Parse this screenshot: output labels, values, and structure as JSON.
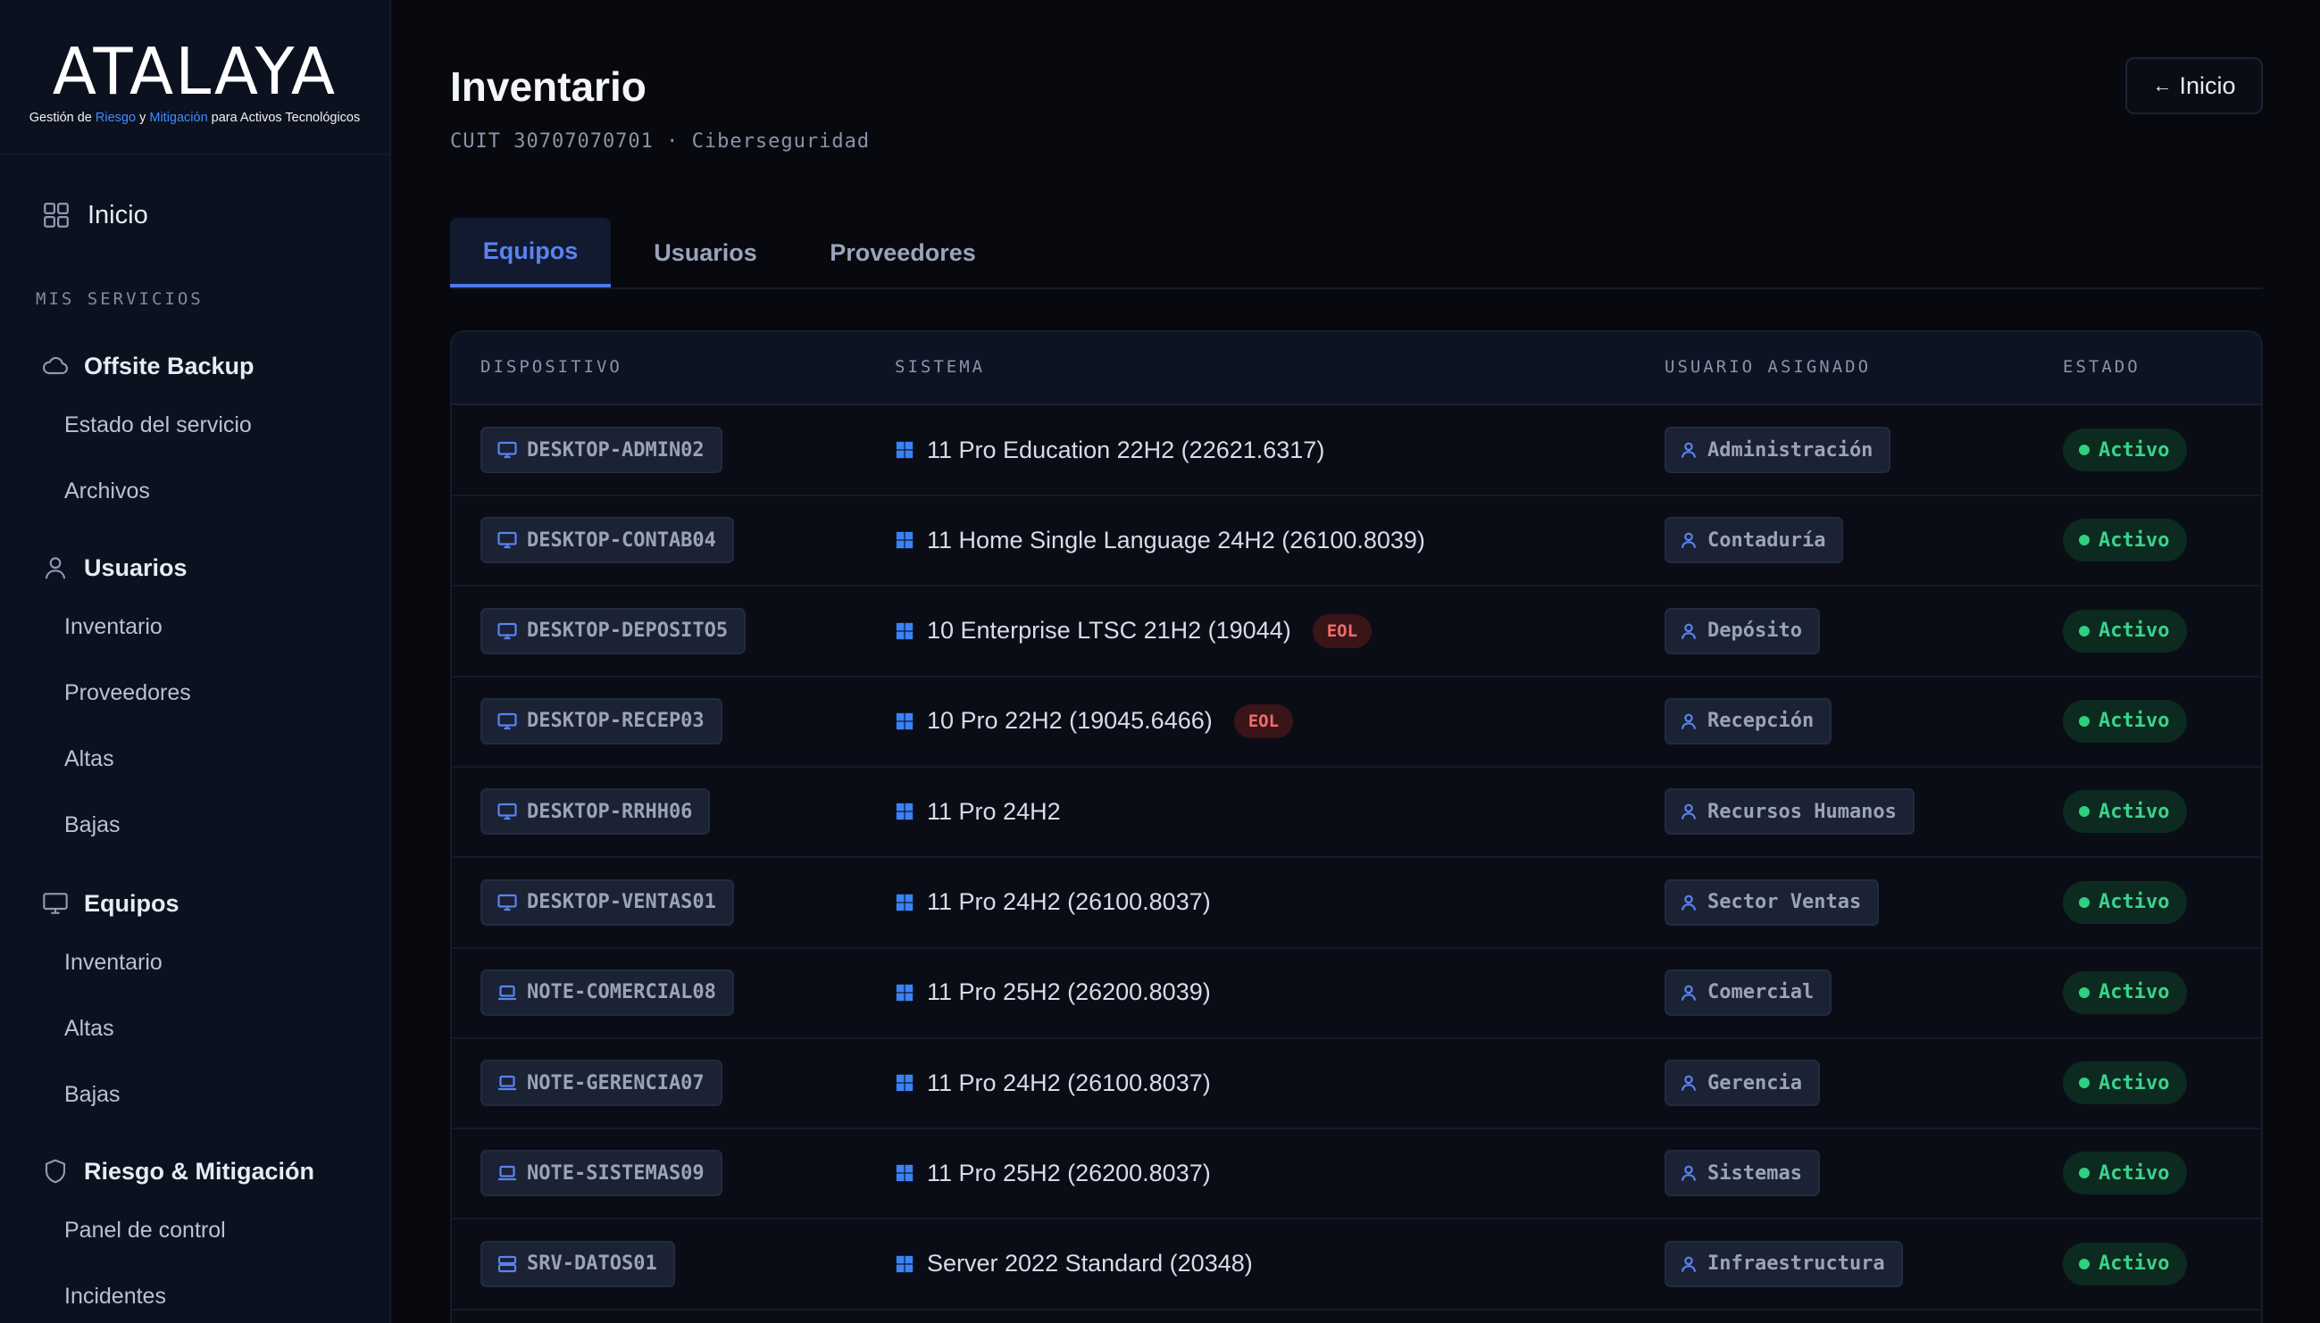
{
  "brand": {
    "name": "ATALAYA",
    "tagline_parts": [
      "Gestión de ",
      "Riesgo",
      " y ",
      "Mitigación",
      " para Activos Tecnológicos"
    ]
  },
  "sidebar": {
    "home": "Inicio",
    "section_label": "MIS SERVICIOS",
    "groups": [
      {
        "title": "Offsite Backup",
        "items": [
          "Estado del servicio",
          "Archivos"
        ]
      },
      {
        "title": "Usuarios",
        "items": [
          "Inventario",
          "Proveedores",
          "Altas",
          "Bajas"
        ]
      },
      {
        "title": "Equipos",
        "items": [
          "Inventario",
          "Altas",
          "Bajas"
        ]
      },
      {
        "title": "Riesgo & Mitigación",
        "items": [
          "Panel de control",
          "Incidentes"
        ]
      }
    ]
  },
  "header": {
    "title": "Inventario",
    "subtitle": "CUIT 30707070701 · Ciberseguridad",
    "home_button": "Inicio",
    "home_arrow": "←"
  },
  "tabs": [
    "Equipos",
    "Usuarios",
    "Proveedores"
  ],
  "table": {
    "columns": [
      "DISPOSITIVO",
      "SISTEMA",
      "USUARIO ASIGNADO",
      "ESTADO"
    ],
    "eol_label": "EOL",
    "rows": [
      {
        "device": "DESKTOP-ADMIN02",
        "type": "desktop",
        "system": "11 Pro Education 22H2 (22621.6317)",
        "eol": false,
        "user": "Administración",
        "status": "Activo"
      },
      {
        "device": "DESKTOP-CONTAB04",
        "type": "desktop",
        "system": "11 Home Single Language 24H2 (26100.8039)",
        "eol": false,
        "user": "Contaduría",
        "status": "Activo"
      },
      {
        "device": "DESKTOP-DEPOSITO5",
        "type": "desktop",
        "system": "10 Enterprise LTSC 21H2 (19044)",
        "eol": true,
        "user": "Depósito",
        "status": "Activo"
      },
      {
        "device": "DESKTOP-RECEP03",
        "type": "desktop",
        "system": "10 Pro 22H2 (19045.6466)",
        "eol": true,
        "user": "Recepción",
        "status": "Activo"
      },
      {
        "device": "DESKTOP-RRHH06",
        "type": "desktop",
        "system": "11 Pro 24H2",
        "eol": false,
        "user": "Recursos Humanos",
        "status": "Activo"
      },
      {
        "device": "DESKTOP-VENTAS01",
        "type": "desktop",
        "system": "11 Pro 24H2 (26100.8037)",
        "eol": false,
        "user": "Sector Ventas",
        "status": "Activo"
      },
      {
        "device": "NOTE-COMERCIAL08",
        "type": "laptop",
        "system": "11 Pro 25H2 (26200.8039)",
        "eol": false,
        "user": "Comercial",
        "status": "Activo"
      },
      {
        "device": "NOTE-GERENCIA07",
        "type": "laptop",
        "system": "11 Pro 24H2 (26100.8037)",
        "eol": false,
        "user": "Gerencia",
        "status": "Activo"
      },
      {
        "device": "NOTE-SISTEMAS09",
        "type": "laptop",
        "system": "11 Pro 25H2 (26200.8037)",
        "eol": false,
        "user": "Sistemas",
        "status": "Activo"
      },
      {
        "device": "SRV-DATOS01",
        "type": "server",
        "system": "Server 2022 Standard (20348)",
        "eol": false,
        "user": "Infraestructura",
        "status": "Activo"
      }
    ]
  },
  "colors": {
    "accent": "#4f78ea",
    "status_green": "#39d38b",
    "eol_red": "#f26b6b",
    "windows_blue": "#3b82f6"
  }
}
